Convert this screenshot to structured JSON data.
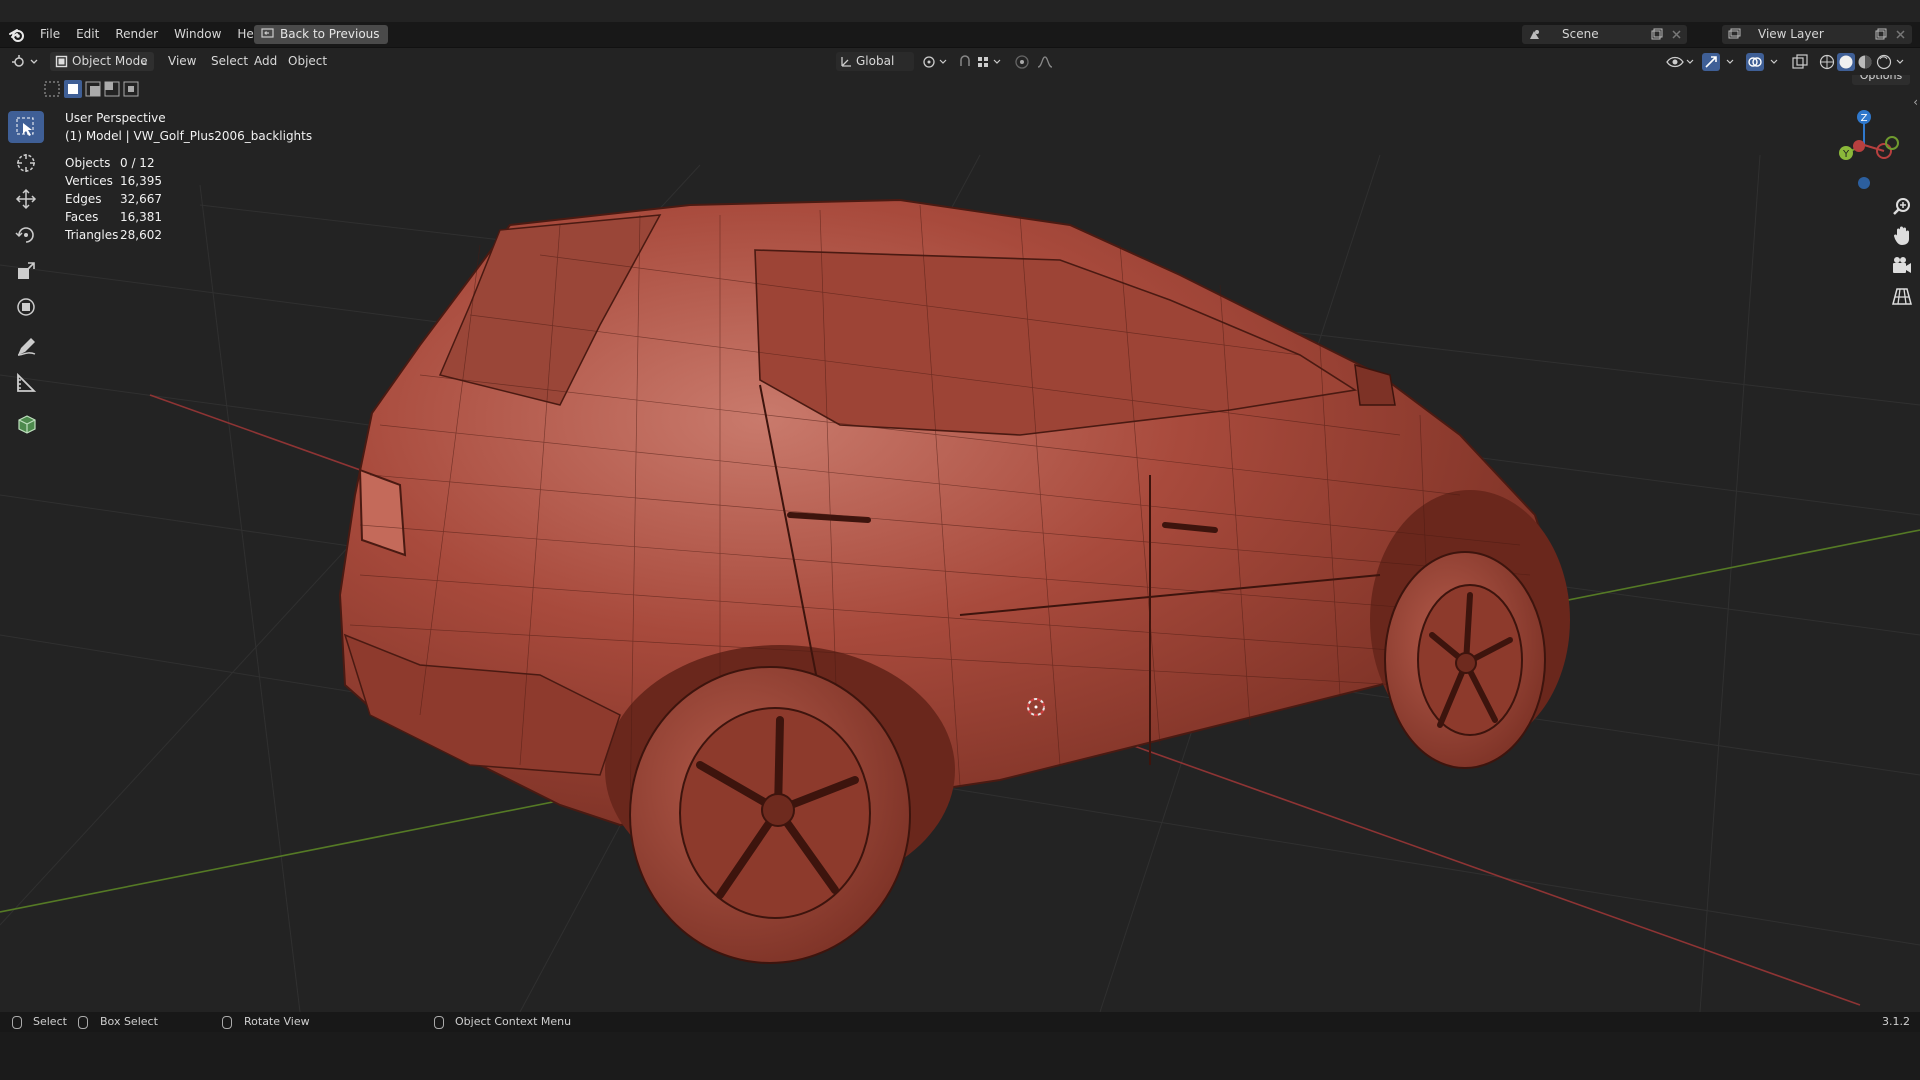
{
  "menu": {
    "items": [
      "File",
      "Edit",
      "Render",
      "Window",
      "Help"
    ],
    "back_button": "Back to Previous"
  },
  "scene": {
    "label": "Scene"
  },
  "view_layer": {
    "label": "View Layer"
  },
  "viewport_header": {
    "mode": "Object Mode",
    "menus": [
      "View",
      "Select",
      "Add",
      "Object"
    ],
    "orientation": "Global",
    "options": "Options"
  },
  "viewport": {
    "perspective": "User Perspective",
    "object_info": "(1) Model | VW_Golf_Plus2006_backlights",
    "stats": [
      {
        "label": "Objects",
        "value": "0 / 12"
      },
      {
        "label": "Vertices",
        "value": "16,395"
      },
      {
        "label": "Edges",
        "value": "32,667"
      },
      {
        "label": "Faces",
        "value": "16,381"
      },
      {
        "label": "Triangles",
        "value": "28,602"
      }
    ],
    "gizmo": {
      "z": "Z",
      "y": "Y",
      "x": "X"
    }
  },
  "status": {
    "select": "Select",
    "box_select": "Box Select",
    "rotate_view": "Rotate View",
    "context_menu": "Object Context Menu",
    "version": "3.1.2"
  },
  "tools": [
    "select-box-tool",
    "cursor-tool",
    "move-tool",
    "rotate-tool",
    "scale-tool",
    "transform-tool",
    "annotate-tool",
    "measure-tool",
    "add-cube-tool"
  ],
  "colors": {
    "accent": "#3f5f96",
    "car_body": "#a84a3c",
    "x_axis": "#b8403f",
    "y_axis": "#6f9a2f",
    "z_axis": "#2f78cc"
  }
}
